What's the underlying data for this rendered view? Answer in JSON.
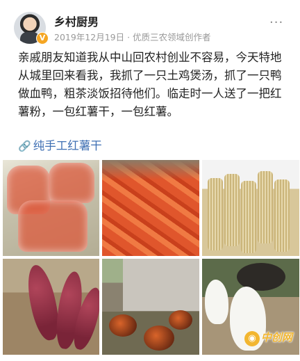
{
  "author": {
    "name": "乡村厨男",
    "verified_badge": "V",
    "meta": "2019年12月19日 · 优质三农领域创作者"
  },
  "post": {
    "text": "亲戚朋友知道我从中山回农村创业不容易，今天特地从城里回来看我，我抓了一只土鸡煲汤，抓了一只鸭做血鸭，粗茶淡饭招待他们。临走时一人送了一把红薯粉，一包红薯干，一包红薯。",
    "topic_icon": "link-icon",
    "topic": "纯手工红薯干"
  },
  "more_icon": "more-dots-icon",
  "watermark": {
    "mark": "◉",
    "text": "中创网"
  },
  "colors": {
    "topic": "#3e6fb3",
    "meta": "#999999",
    "badge": "#f5a623",
    "watermark": "#f2b630"
  }
}
